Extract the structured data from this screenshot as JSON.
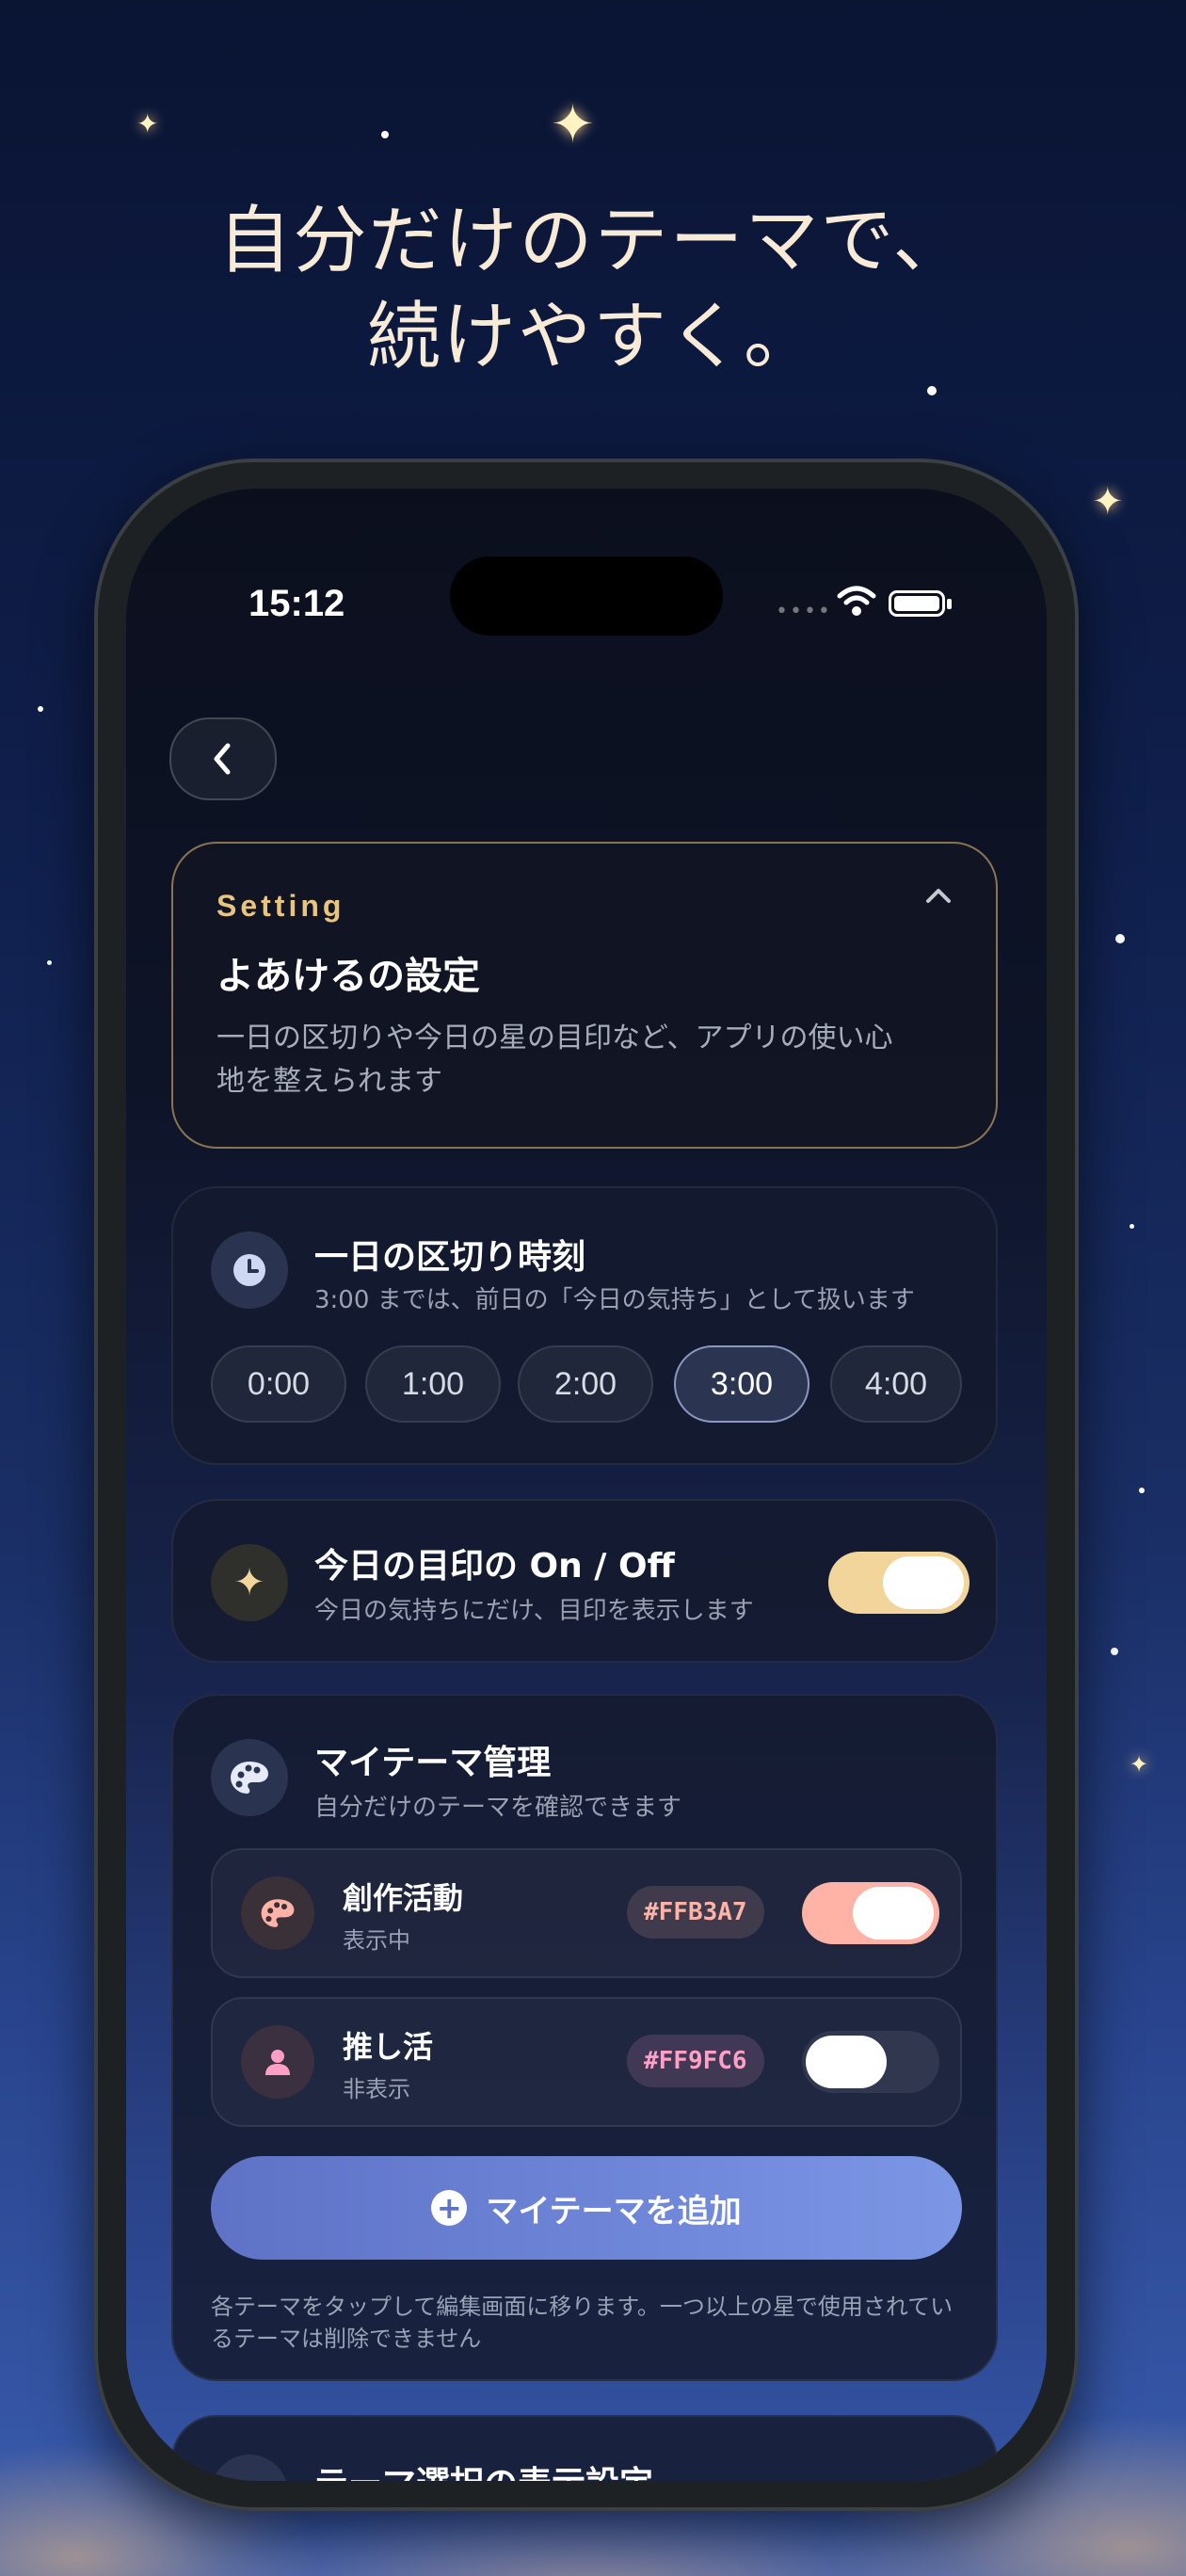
{
  "headline": {
    "line1": "自分だけのテーマで、",
    "line2": "続けやすく。"
  },
  "status_bar": {
    "time": "15:12"
  },
  "nav": {
    "back_icon": "chevron-left-icon",
    "back_glyph": "‹"
  },
  "hero": {
    "eyebrow": "Setting",
    "collapse_glyph": "︿",
    "title": "よあけるの設定",
    "description": "一日の区切りや今日の星の目印など、アプリの使い心地を整えられます"
  },
  "day_cutoff": {
    "icon": "clock-icon",
    "title": "一日の区切り時刻",
    "subtitle": "3:00 までは、前日の「今日の気持ち」として扱います",
    "options": [
      "0:00",
      "1:00",
      "2:00",
      "3:00",
      "4:00"
    ],
    "selected": "3:00"
  },
  "daily_marker": {
    "icon": "sparkles-icon",
    "icon_glyph": "✦",
    "title": "今日の目印の On / Off",
    "subtitle": "今日の気持ちにだけ、目印を表示します",
    "enabled": true,
    "toggle_color": "#F2D59A"
  },
  "my_themes": {
    "icon": "palette-icon",
    "title": "マイテーマ管理",
    "subtitle": "自分だけのテーマを確認できます",
    "items": [
      {
        "name": "創作活動",
        "status": "表示中",
        "hex": "#FFB3A7",
        "enabled": true,
        "icon": "palette-icon"
      },
      {
        "name": "推し活",
        "status": "非表示",
        "hex": "#FF9FC6",
        "enabled": false,
        "icon": "person-icon"
      }
    ],
    "add_button": "マイテーマを追加",
    "footnote": "各テーマをタップして編集画面に移ります。一つ以上の星で使用されているテーマは削除できません"
  },
  "next_section": {
    "title": "テーマ選択の表示設定"
  },
  "colors": {
    "accent_gold": "#E8C57F",
    "add_button_start": "#5E72C6",
    "add_button_end": "#7C96E6"
  }
}
